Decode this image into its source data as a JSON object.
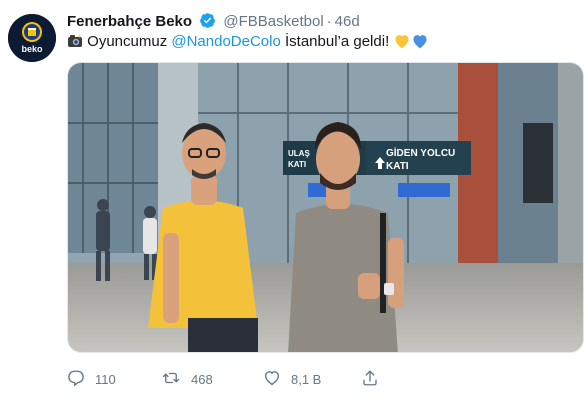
{
  "tweet": {
    "display_name": "Fenerbahçe Beko",
    "handle": "@FBBasketbol",
    "separator": "·",
    "timestamp": "46d",
    "avatar_icon": "fenerbahce-beko-logo",
    "avatar_wordmark": "beko",
    "verified_icon": "verified-badge-icon",
    "text_before_mention": "Oyuncumuz ",
    "mention": "@NandoDeColo",
    "text_after_mention": " İstanbul’a geldi!",
    "camera_emoji_icon": "camera-flash-icon",
    "heart_emojis": [
      "yellow-heart",
      "blue-heart"
    ],
    "photo_alt": "Two men posing at airport arrival terminal",
    "photo_signs": {
      "left_sign_partial": "ULAŞ\nKATI",
      "right_sign": "GİDEN YOLCU\nKATI"
    }
  },
  "actions": {
    "reply": {
      "icon": "reply-icon",
      "count": "110"
    },
    "retweet": {
      "icon": "retweet-icon",
      "count": "468"
    },
    "like": {
      "icon": "heart-icon",
      "count": "8,1 B"
    },
    "share": {
      "icon": "share-icon",
      "count": ""
    }
  },
  "colors": {
    "text_primary": "#14171a",
    "text_secondary": "#657786",
    "link": "#1b95e0",
    "verified": "#1da1f2",
    "heart_yellow": "#f8c53a",
    "heart_blue": "#4a90e2"
  }
}
